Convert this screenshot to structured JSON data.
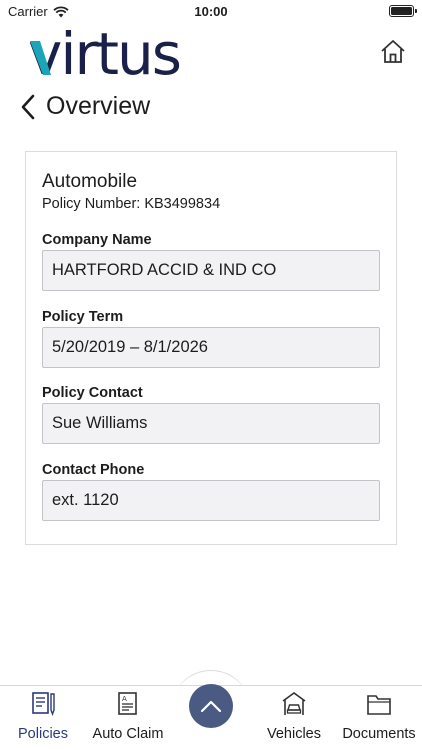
{
  "status_bar": {
    "carrier": "Carrier",
    "time": "10:00"
  },
  "header": {
    "logo_text": "virtus",
    "back_label": "Overview"
  },
  "policy": {
    "type": "Automobile",
    "policy_number_label": "Policy Number: KB3499834",
    "fields": [
      {
        "label": "Company Name",
        "value": "HARTFORD ACCID & IND CO"
      },
      {
        "label": "Policy Term",
        "value": "5/20/2019 – 8/1/2026"
      },
      {
        "label": "Policy Contact",
        "value": "Sue Williams"
      },
      {
        "label": "Contact Phone",
        "value": "ext. 1120"
      }
    ]
  },
  "tab_bar": {
    "tabs": [
      {
        "label": "Policies",
        "icon": "policies-document-icon",
        "active": true
      },
      {
        "label": "Auto Claim",
        "icon": "auto-claim-form-icon",
        "active": false
      },
      {
        "label": "Vehicles",
        "icon": "vehicles-garage-car-icon",
        "active": false
      },
      {
        "label": "Documents",
        "icon": "documents-folder-icon",
        "active": false
      }
    ],
    "fab_icon": "chevron-up-icon"
  },
  "colors": {
    "brand_navy": "#1b2048",
    "brand_teal": "#1aa5b8",
    "fab": "#4a5a82",
    "field_bg": "#f2f2f4"
  }
}
